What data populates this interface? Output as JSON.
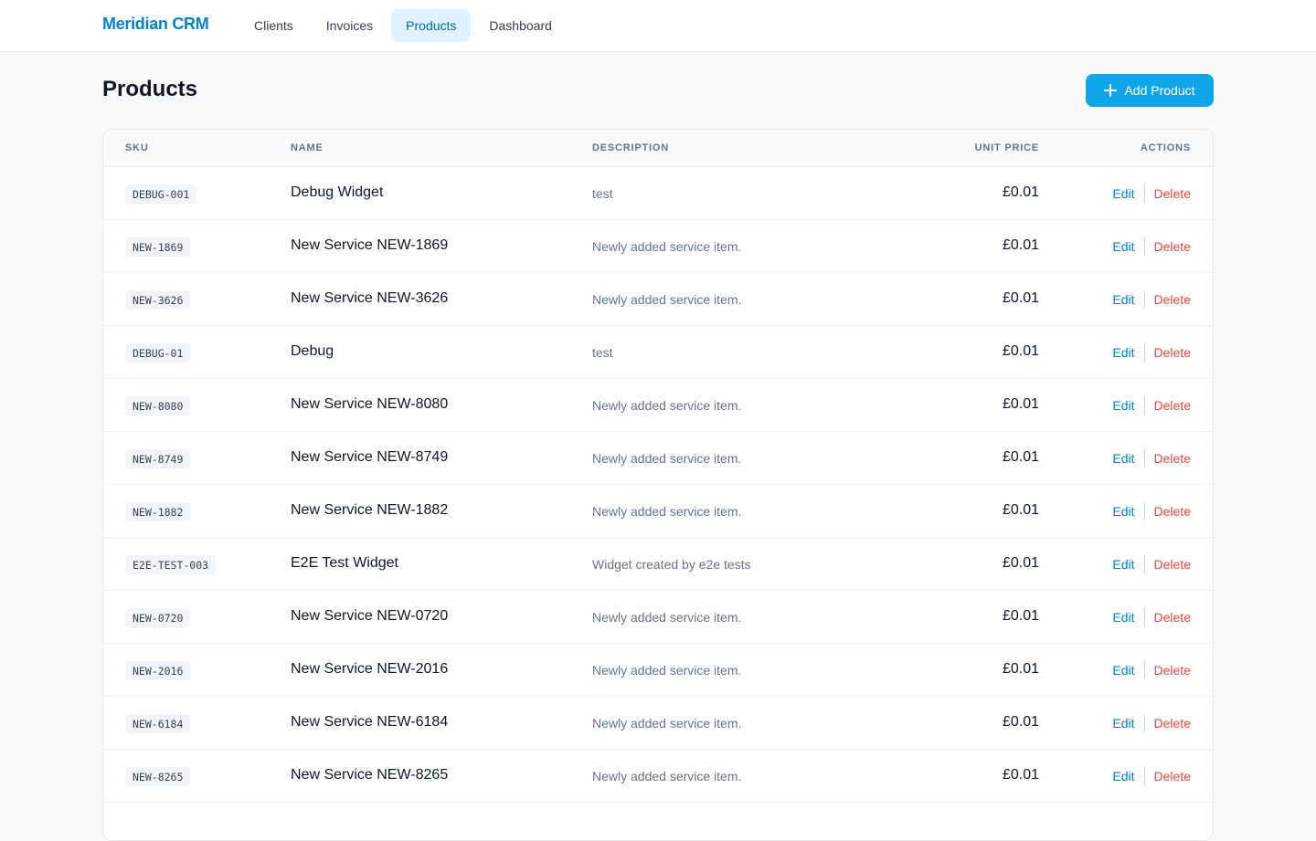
{
  "app": {
    "brand": "Meridian CRM",
    "nav": [
      "Clients",
      "Invoices",
      "Products",
      "Dashboard"
    ],
    "active_nav": "Products"
  },
  "page": {
    "title": "Products",
    "add_button_label": "Add Product",
    "add_button_icon": "plus-icon"
  },
  "table": {
    "headers": {
      "sku": "SKU",
      "name": "NAME",
      "description": "DESCRIPTION",
      "unit_price": "UNIT PRICE",
      "actions": "ACTIONS"
    },
    "action_labels": {
      "edit": "Edit",
      "delete": "Delete"
    },
    "rows": [
      {
        "sku": "DEBUG-001",
        "name": "Debug Widget",
        "description": "test",
        "price": "£0.01"
      },
      {
        "sku": "NEW-1869",
        "name": "New Service NEW-1869",
        "description": "Newly added service item.",
        "price": "£0.01"
      },
      {
        "sku": "NEW-3626",
        "name": "New Service NEW-3626",
        "description": "Newly added service item.",
        "price": "£0.01"
      },
      {
        "sku": "DEBUG-01",
        "name": "Debug",
        "description": "test",
        "price": "£0.01"
      },
      {
        "sku": "NEW-8080",
        "name": "New Service NEW-8080",
        "description": "Newly added service item.",
        "price": "£0.01"
      },
      {
        "sku": "NEW-8749",
        "name": "New Service NEW-8749",
        "description": "Newly added service item.",
        "price": "£0.01"
      },
      {
        "sku": "NEW-1882",
        "name": "New Service NEW-1882",
        "description": "Newly added service item.",
        "price": "£0.01"
      },
      {
        "sku": "E2E-TEST-003",
        "name": "E2E Test Widget",
        "description": "Widget created by e2e tests",
        "price": "£0.01"
      },
      {
        "sku": "NEW-0720",
        "name": "New Service NEW-0720",
        "description": "Newly added service item.",
        "price": "£0.01"
      },
      {
        "sku": "NEW-2016",
        "name": "New Service NEW-2016",
        "description": "Newly added service item.",
        "price": "£0.01"
      },
      {
        "sku": "NEW-6184",
        "name": "New Service NEW-6184",
        "description": "Newly added service item.",
        "price": "£0.01"
      },
      {
        "sku": "NEW-8265",
        "name": "New Service NEW-8265",
        "description": "Newly added service item.",
        "price": "£0.01"
      }
    ]
  },
  "colors": {
    "accent": "#0ea5e9",
    "brand": "#0284c7",
    "danger": "#ef4444"
  }
}
